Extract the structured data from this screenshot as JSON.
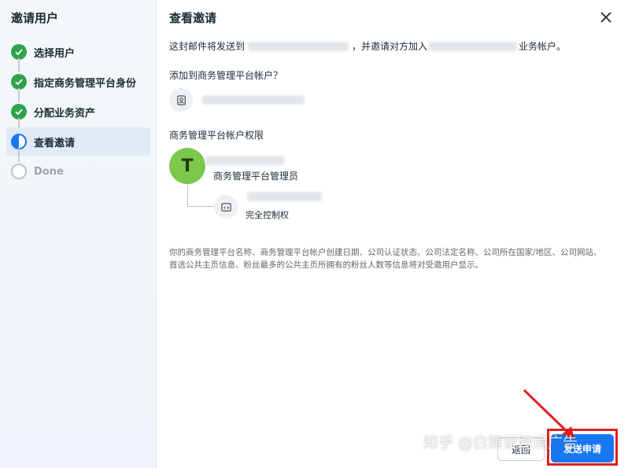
{
  "sidebar": {
    "title": "邀请用户",
    "steps": [
      {
        "label": "选择用户",
        "state": "done"
      },
      {
        "label": "指定商务管理平台身份",
        "state": "done"
      },
      {
        "label": "分配业务资产",
        "state": "done"
      },
      {
        "label": "查看邀请",
        "state": "current"
      },
      {
        "label": "Done",
        "state": "todo"
      }
    ]
  },
  "main": {
    "title": "查看邀请",
    "sentence_part1": "这封邮件将发送到",
    "sentence_part2": "，并邀请对方加入",
    "sentence_part3": "业务帐户。",
    "add_question": "添加到商务管理平台帐户？",
    "permissions_title": "商务管理平台帐户权限",
    "avatar_letter": "T",
    "admin_role": "商务管理平台管理员",
    "full_control": "完全控制权",
    "note": "你的商务管理平台名称、商务管理平台帐户创建日期、公司认证状态、公司法定名称、公司所在国家/地区、公司网站、首选公共主页信息、粉丝最多的公共主页所拥有的粉丝人数等信息将对受邀用户显示。"
  },
  "footer": {
    "back_label": "返回",
    "send_label": "发送申请"
  },
  "watermark": "知乎 @白熊说跨境广告",
  "colors": {
    "accent": "#1877f2",
    "done": "#31a24c",
    "annotation": "#e02020"
  },
  "icons": {
    "close": "close-icon",
    "check": "check-icon",
    "account": "account-icon",
    "code": "code-icon"
  }
}
